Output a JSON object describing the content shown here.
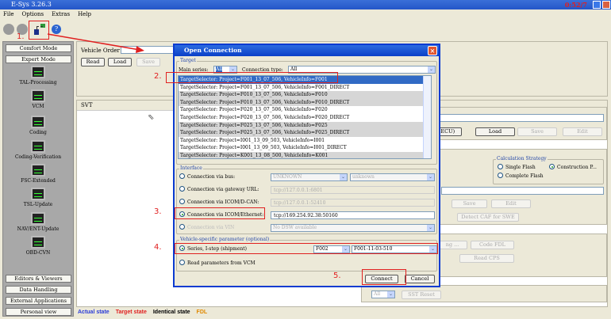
{
  "app": {
    "title": "E-Sys 3.26.3",
    "clock": "0:52/7"
  },
  "menu": [
    "File",
    "Options",
    "Extras",
    "Help"
  ],
  "left": {
    "top_buttons": [
      "Comfort Mode",
      "Expert Mode"
    ],
    "tools": [
      "TAL-Processing",
      "VCM",
      "Coding",
      "Coding-Verification",
      "FSC-Extended",
      "TSL-Update",
      "NAV/ENT-Update",
      "OBD-CVN"
    ],
    "bottom_buttons": [
      "Editors & Viewers",
      "Data Handling",
      "External Applications",
      "Personal view"
    ]
  },
  "main": {
    "vehicle_order_label": "Vehicle Order",
    "read": "Read",
    "load": "Load",
    "save": "Save",
    "svt_label": "SVT",
    "right": {
      "ecu_btn": "(ECU)",
      "load": "Load",
      "save": "Save",
      "edit": "Edit",
      "calc_title": "Calculation Strategy",
      "single_flash": "Single Flash",
      "construction": "Construction P...",
      "complete_flash": "Complete Flash",
      "save2": "Save",
      "edit2": "Edit",
      "detect": "Detect CAF for SWE",
      "coding": "ng ...",
      "code_fdl": "Code FDL",
      "read_cps": "Read CPS",
      "all": "All",
      "sst_reset": "SST Reset"
    },
    "legend": {
      "actual": "Actual state",
      "target": "Target state",
      "identical": "Identical state",
      "fdl": "FDL"
    },
    "colors": {
      "actual": "#2a3bd8",
      "target": "#e02020",
      "identical": "#000000",
      "fdl": "#e08a00"
    }
  },
  "dialog": {
    "title": "Open Connection",
    "target_group": "Target",
    "main_series_label": "Main series:",
    "main_series_value": "All",
    "conn_type_label": "Connection type:",
    "conn_type_value": "All",
    "targets": [
      "TargetSelector: Project=F001_13_07_506, VehicleInfo=F001",
      "TargetSelector: Project=F001_13_07_506, VehicleInfo=F001_DIRECT",
      "TargetSelector: Project=F010_13_07_506, VehicleInfo=F010",
      "TargetSelector: Project=F010_13_07_506, VehicleInfo=F010_DIRECT",
      "TargetSelector: Project=F020_13_07_506, VehicleInfo=F020",
      "TargetSelector: Project=F020_13_07_506, VehicleInfo=F020_DIRECT",
      "TargetSelector: Project=F025_13_07_506, VehicleInfo=F025",
      "TargetSelector: Project=F025_13_07_506, VehicleInfo=F025_DIRECT",
      "TargetSelector: Project=I001_13_09_503, VehicleInfo=I001",
      "TargetSelector: Project=I001_13_09_503, VehicleInfo=I001_DIRECT",
      "TargetSelector: Project=K001_13_08_500, VehicleInfo=K001"
    ],
    "interface_group": "Interface",
    "via_bus": "Connection via bus:",
    "bus_value": "UNKNOWN",
    "bus_value2": "unknown",
    "via_gateway": "Connection via gateway URL:",
    "gateway_value": "tcp://127.0.0.1:6801",
    "via_dcan": "Connection via ICOM/D-CAN:",
    "dcan_value": "tcp://127.0.0.1:52410",
    "via_eth": "Connection via ICOM/Ethernet:",
    "eth_value": "tcp://169.254.92.38:50160",
    "via_vin": "Connection via VIN",
    "vin_value": "No DSW available",
    "vehicle_group": "Vehicle-specific parameter (optional)",
    "series_label": "Series, I-step (shipment)",
    "series_value": "F002",
    "istep_value": "F001-11-03-510",
    "read_vcm": "Read parameters from VCM",
    "connect": "Connect",
    "cancel": "Cancel"
  },
  "annotations": [
    "1.",
    "2.",
    "3.",
    "4.",
    "5."
  ]
}
